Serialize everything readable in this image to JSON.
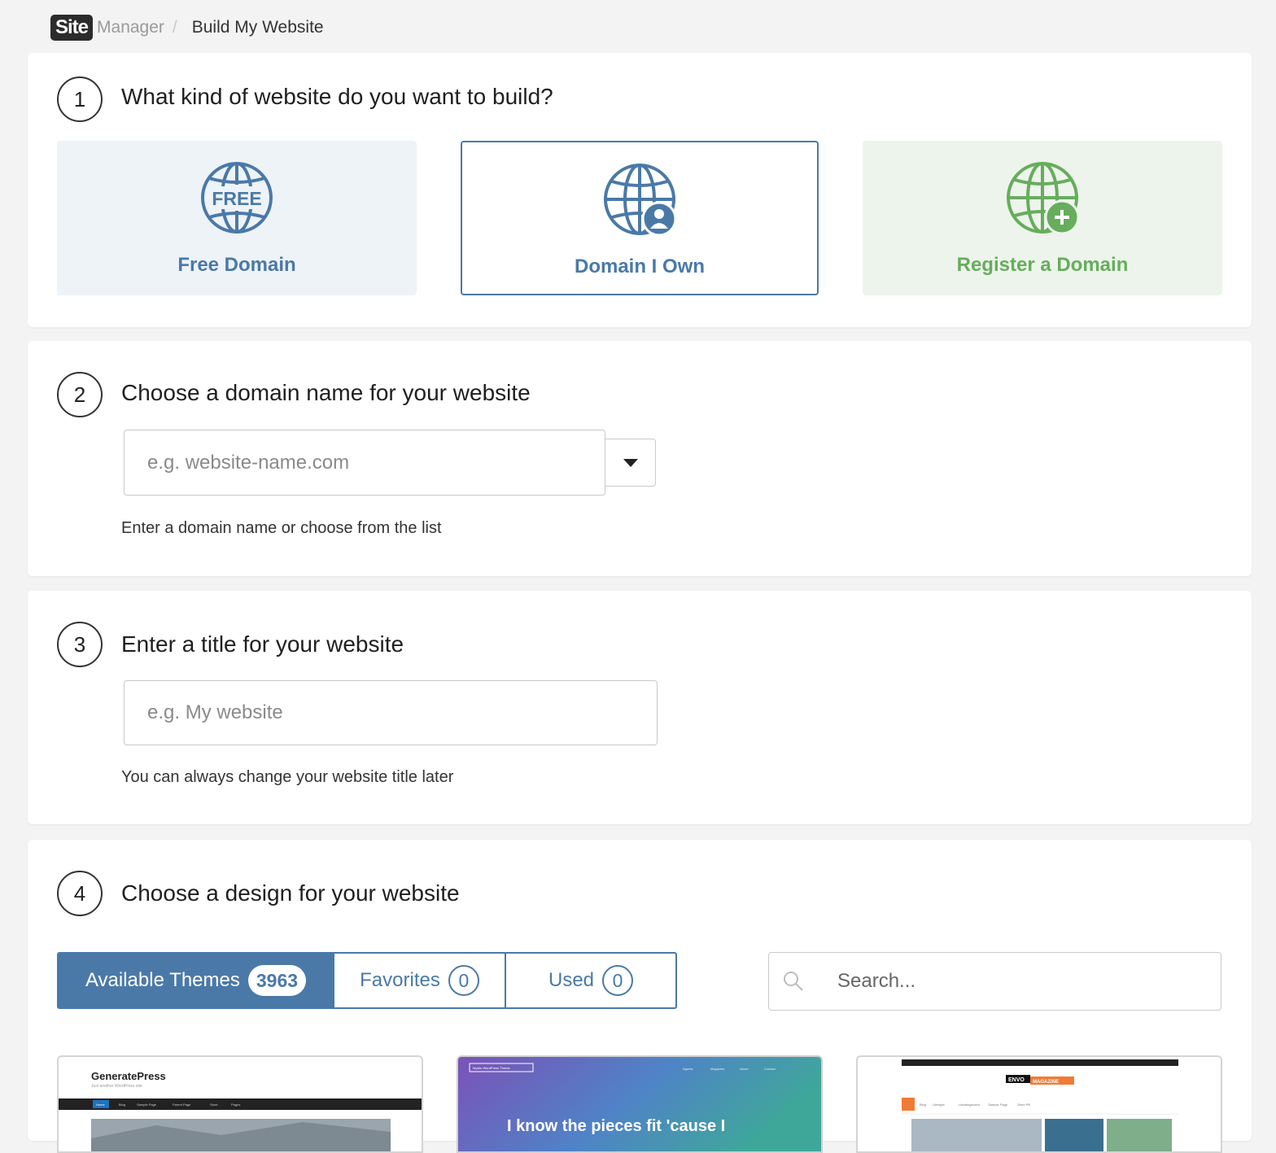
{
  "breadcrumb": {
    "logo_text": "Site",
    "logo_suffix": "Manager",
    "separator": "/",
    "current": "Build My Website"
  },
  "step1": {
    "number": "1",
    "title": "What kind of website do you want to build?",
    "options": [
      {
        "label": "Free Domain",
        "icon": "free-globe-icon",
        "icon_text": "FREE",
        "color": "#4a79a8"
      },
      {
        "label": "Domain I Own",
        "icon": "globe-user-icon",
        "color": "#4a79a8",
        "selected": true
      },
      {
        "label": "Register a Domain",
        "icon": "globe-plus-icon",
        "color": "#66ad5c"
      }
    ]
  },
  "step2": {
    "number": "2",
    "title": "Choose a domain name for your website",
    "placeholder": "e.g. website-name.com",
    "help": "Enter a domain name or choose from the list"
  },
  "step3": {
    "number": "3",
    "title": "Enter a title for your website",
    "placeholder": "e.g. My website",
    "help": "You can always change your website title later"
  },
  "step4": {
    "number": "4",
    "title": "Choose a design for your website",
    "tabs": [
      {
        "label": "Available Themes",
        "count": "3963",
        "active": true
      },
      {
        "label": "Favorites",
        "count": "0"
      },
      {
        "label": "Used",
        "count": "0"
      }
    ],
    "search_placeholder": "Search...",
    "themes": [
      {
        "name": "GeneratePress",
        "tagline": "Just another WordPress site",
        "nav": [
          "Home",
          "Blog",
          "Sample Page",
          "Parent Page",
          "Store",
          "Pages"
        ]
      },
      {
        "name": "Mystic WordPress Theme",
        "headline": "I know the pieces fit 'cause I",
        "nav": [
          "Agents",
          "Magazine",
          "About",
          "Contact"
        ]
      },
      {
        "name": "ENVO",
        "name_suffix": "MAGAZINE",
        "nav": [
          "Blog",
          "Lifestyle",
          "Uncategorized",
          "Sample Page",
          "Store PB"
        ]
      }
    ]
  },
  "colors": {
    "primary": "#4a79a8",
    "green": "#66ad5c",
    "free_bg": "#eef3f8",
    "register_bg": "#edf4ec",
    "page_bg": "#f3f3f3"
  }
}
